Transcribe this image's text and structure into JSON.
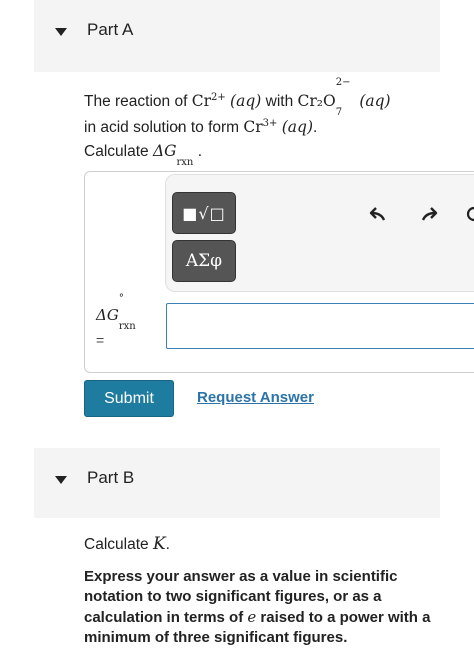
{
  "partA": {
    "title": "Part A",
    "q_line1_pre": "The reaction of ",
    "cr_species": "Cr",
    "cr_charge": "2+",
    "aq1": "(aq)",
    "with_text": " with ",
    "dichromate": "Cr₂O",
    "dichromate_sub": "7",
    "dichromate_sup": "2−",
    "aq2": "(aq)",
    "q_line2_pre": "in acid solution to form ",
    "cr3_species": "Cr",
    "cr3_charge": "3+",
    "aq3": "(aq)",
    "q_line2_post": ".",
    "q_line3_pre": "Calculate ",
    "delta_g": "ΔG",
    "g_sup": "°",
    "g_sub": "rxn",
    "q_line3_post": " .",
    "toolbar": {
      "template_btn": "■√□",
      "greek_btn": "ΑΣφ",
      "icons": [
        "undo-icon",
        "redo-icon",
        "reset-icon"
      ]
    },
    "answer_label_delta": "ΔG",
    "answer_label_sup": "°",
    "answer_label_sub": "rxn",
    "answer_label_eq": "=",
    "answer_value": "",
    "submit_label": "Submit",
    "request_label": "Request Answer"
  },
  "partB": {
    "title": "Part B",
    "calc_pre": "Calculate ",
    "calc_var": "K",
    "calc_post": ".",
    "instructions": "Express your answer as a value in scientific notation to two significant figures, or as a calculation in terms of ",
    "instructions_var": "e",
    "instructions_post": " raised to a power with a minimum of three significant figures."
  },
  "colors": {
    "accent": "#1f7ca1",
    "link": "#2b73a8",
    "input_border": "#3a7fb6",
    "header_bg": "#f4f4f4"
  }
}
